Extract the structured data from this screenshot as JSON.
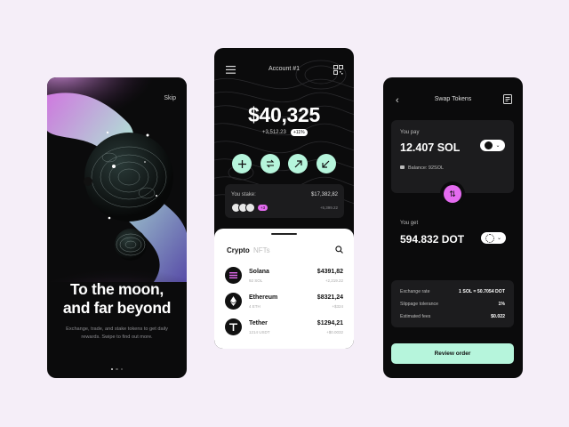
{
  "onboarding": {
    "skip_label": "Skip",
    "headline_line1": "To the moon,",
    "headline_line2": "and far beyond",
    "subtitle": "Exchange, trade, and stake tokens to get daily rewards. Swipe to find out more.",
    "page_count": 3,
    "active_page": 1
  },
  "wallet": {
    "account_title": "Account #1",
    "balance": "$40,325",
    "balance_change": "+3,512.23",
    "balance_change_pct": "+11%",
    "stake": {
      "label": "You stake:",
      "amount": "$17,382,82",
      "change": "+5,399.22",
      "extra_badge": "+3"
    },
    "tabs": {
      "crypto": "Crypto",
      "nfts": "NFTs"
    },
    "assets": [
      {
        "name": "Solana",
        "amount": "92 SOL",
        "value": "$4391,82",
        "change": "+2,219.22"
      },
      {
        "name": "Ethereum",
        "amount": "4 ETH",
        "value": "$8321,24",
        "change": "+$324"
      },
      {
        "name": "Tether",
        "amount": "1214 USDT",
        "value": "$1294,21",
        "change": "+$0.0032"
      }
    ]
  },
  "swap": {
    "title": "Swap Tokens",
    "you_pay_label": "You pay",
    "you_pay_value": "12.407 SOL",
    "balance_label": "Balance: 92SOL",
    "you_get_label": "You get",
    "you_get_value": "594.832 DOT",
    "details": [
      {
        "label": "Exchange rate",
        "value": "1 SOL = 50.7054 DOT"
      },
      {
        "label": "Slippage tolerance",
        "value": "1%"
      },
      {
        "label": "Estimated fees",
        "value": "$0.022"
      }
    ],
    "review_label": "Review order"
  },
  "colors": {
    "background": "#f5eef8",
    "mint": "#b6f5dc",
    "pink": "#e46bf0",
    "phone": "#0b0b0c"
  }
}
